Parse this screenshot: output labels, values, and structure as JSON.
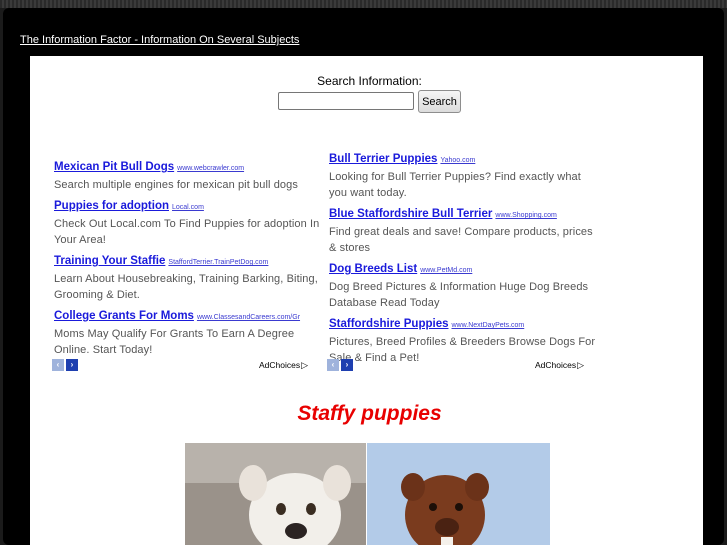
{
  "site": {
    "title": "The Information Factor - Information On Several Subjects"
  },
  "search": {
    "label": "Search Information:",
    "button_label": "Search",
    "value": "",
    "placeholder": ""
  },
  "ads": {
    "left": [
      {
        "title": "Mexican Pit Bull Dogs",
        "url": "www.webcrawler.com",
        "desc": "Search multiple engines for mexican pit bull dogs"
      },
      {
        "title": "Puppies for adoption",
        "url": "Local.com",
        "desc": "Check Out Local.com To Find Puppies for adoption In Your Area!"
      },
      {
        "title": "Training Your Staffie",
        "url": "StaffordTerrier.TrainPetDog.com",
        "desc": "Learn About Housebreaking, Training Barking, Biting, Grooming & Diet."
      },
      {
        "title": "College Grants For Moms",
        "url": "www.ClassesandCareers.com/Gr",
        "desc": "Moms May Qualify For Grants To Earn A Degree Online. Start Today!"
      }
    ],
    "right": [
      {
        "title": "Bull Terrier Puppies",
        "url": "Yahoo.com",
        "desc": "Looking for Bull Terrier Puppies? Find exactly what you want today."
      },
      {
        "title": "Blue Staffordshire Bull Terrier",
        "url": "www.Shopping.com",
        "desc": "Find great deals and save! Compare products, prices & stores"
      },
      {
        "title": "Dog Breeds List",
        "url": "www.PetMd.com",
        "desc": "Dog Breed Pictures & Information Huge Dog Breeds Database Read Today"
      },
      {
        "title": "Staffordshire Puppies",
        "url": "www.NextDayPets.com",
        "desc": "Pictures, Breed Profiles & Breeders Browse Dogs For Sale & Find a Pet!"
      }
    ],
    "adchoices_label": "AdChoices",
    "prev_icon": "‹",
    "next_icon": "›"
  },
  "content": {
    "heading": "Staffy puppies"
  }
}
